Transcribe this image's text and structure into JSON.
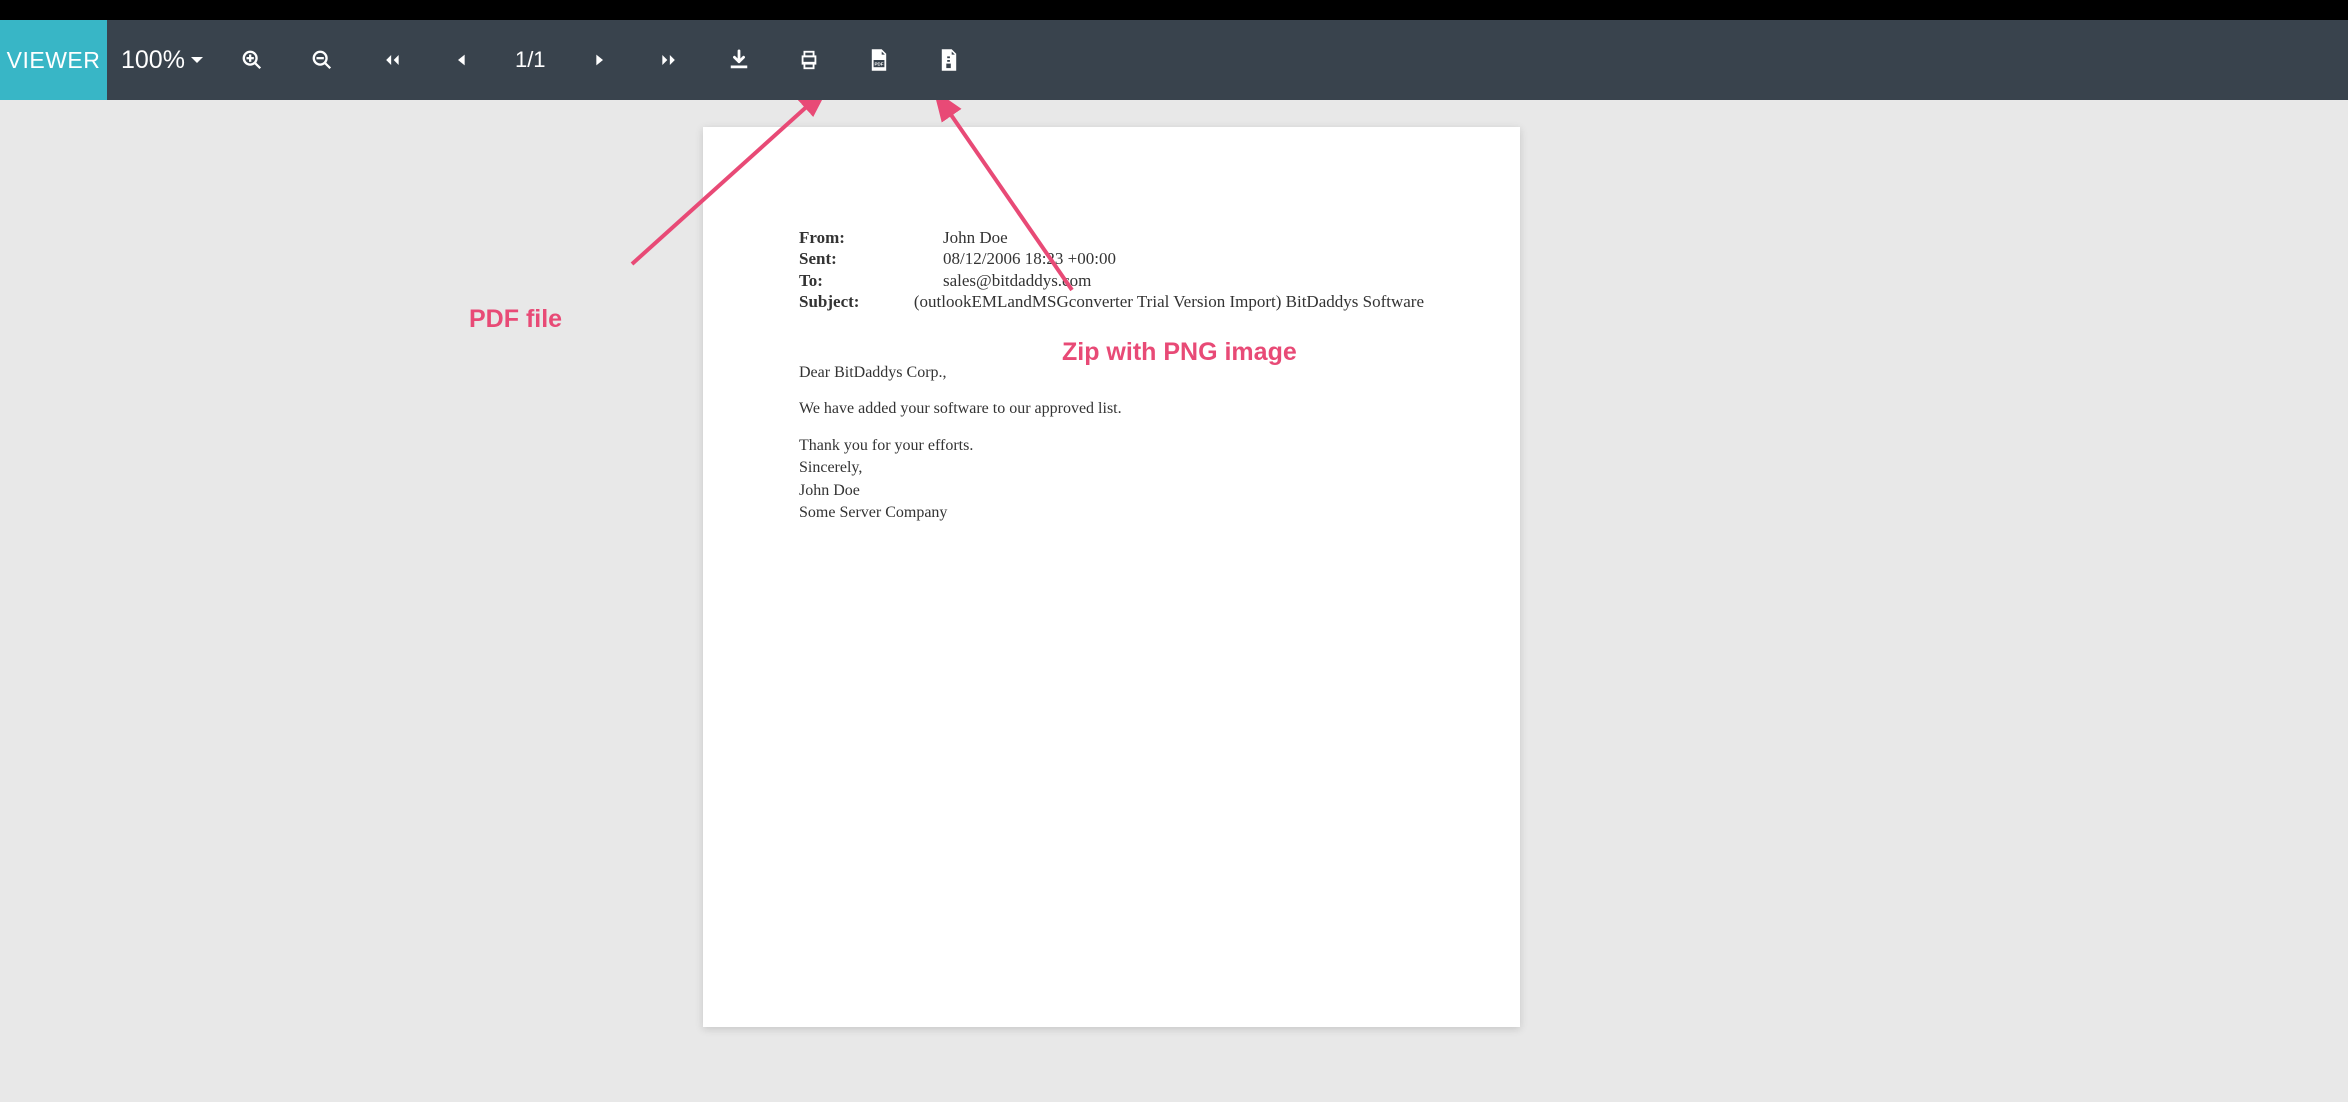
{
  "toolbar": {
    "viewer_label": "VIEWER",
    "zoom_level": "100%",
    "page_indicator": "1/1"
  },
  "email": {
    "headers": {
      "from_label": "From:",
      "from_value": "John Doe",
      "sent_label": "Sent:",
      "sent_value": "08/12/2006 18:23 +00:00",
      "to_label": "To:",
      "to_value": "sales@bitdaddys.com",
      "subject_label": "Subject:",
      "subject_value": "(outlookEMLandMSGconverter Trial Version Import) BitDaddys Software"
    },
    "body": {
      "greeting": "Dear BitDaddys Corp.,",
      "line1": "We have added your software to our approved list.",
      "thanks": "Thank you for your efforts.",
      "signoff1": "Sincerely,",
      "signoff2": "John Doe",
      "signoff3": "Some Server Company"
    }
  },
  "annotations": {
    "pdf_label": "PDF file",
    "zip_label": "Zip with PNG image"
  }
}
